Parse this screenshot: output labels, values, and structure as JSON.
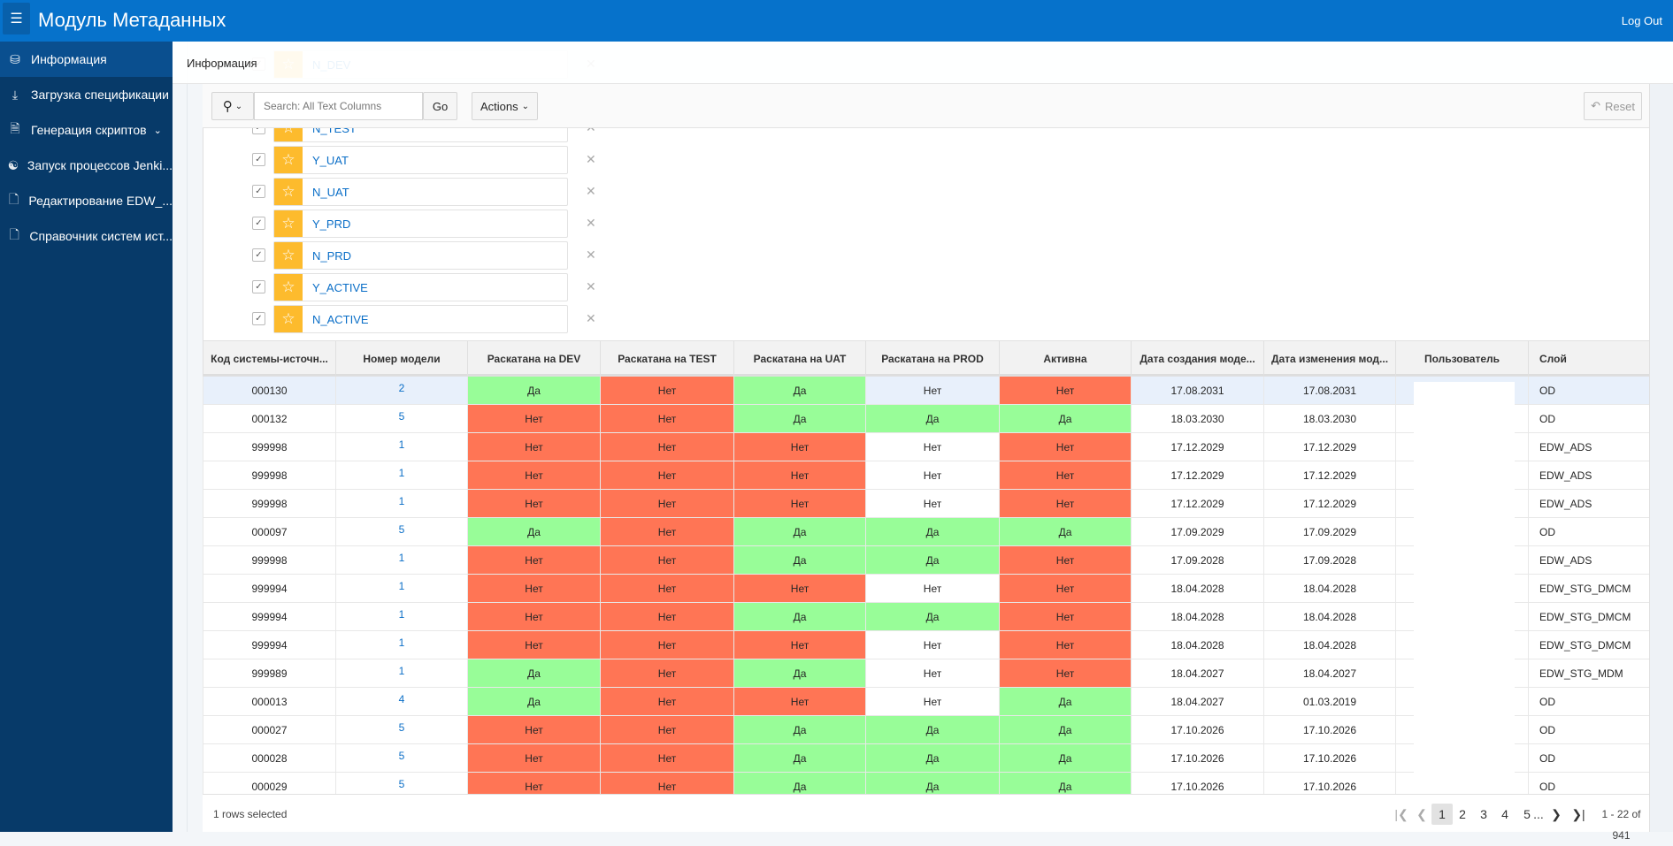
{
  "header": {
    "title": "Модуль Метаданных",
    "logout": "Log Out",
    "menu_icon": "hamburger-icon"
  },
  "sidebar": {
    "items": [
      {
        "label": "Информация",
        "icon": "database-icon",
        "active": true
      },
      {
        "label": "Загрузка спецификации",
        "icon": "download-icon"
      },
      {
        "label": "Генерация скриптов",
        "icon": "file-code-icon",
        "expandable": true
      },
      {
        "label": "Запуск процессов Jenki...",
        "icon": "jenkins-icon"
      },
      {
        "label": "Редактирование EDW_...",
        "icon": "file-icon"
      },
      {
        "label": "Справочник систем ист...",
        "icon": "file-icon"
      }
    ]
  },
  "breadcrumb": {
    "current": "Информация"
  },
  "toolbar": {
    "search_placeholder": "Search: All Text Columns",
    "search_value": "",
    "go": "Go",
    "actions": "Actions",
    "reset": "Reset"
  },
  "highlights": [
    {
      "name": "N_DEV",
      "checked": true
    },
    {
      "name": "N_TEST",
      "checked": true
    },
    {
      "name": "Y_UAT",
      "checked": true
    },
    {
      "name": "N_UAT",
      "checked": true
    },
    {
      "name": "Y_PRD",
      "checked": true
    },
    {
      "name": "N_PRD",
      "checked": true
    },
    {
      "name": "Y_ACTIVE",
      "checked": true
    },
    {
      "name": "N_ACTIVE",
      "checked": true
    }
  ],
  "colors": {
    "yes": "#98fd98",
    "no": "#ff7555",
    "header": "#0672cb",
    "sidebar": "#073a69"
  },
  "table": {
    "columns": [
      "Код системы-источн...",
      "Номер модели",
      "Раскатана на DEV",
      "Раскатана на TEST",
      "Раскатана на UAT",
      "Раскатана на PROD",
      "Активна",
      "Дата создания моде...",
      "Дата изменения мод...",
      "Пользователь",
      "Слой"
    ],
    "rows": [
      [
        "000130",
        "2",
        "Да",
        "Нет",
        "Да",
        "Нет",
        "Нет",
        "17.08.2031",
        "17.08.2031",
        "",
        "OD"
      ],
      [
        "000132",
        "5",
        "Нет",
        "Нет",
        "Да",
        "Да",
        "Да",
        "18.03.2030",
        "18.03.2030",
        "",
        "OD"
      ],
      [
        "999998",
        "1",
        "Нет",
        "Нет",
        "Нет",
        "Нет",
        "Нет",
        "17.12.2029",
        "17.12.2029",
        "",
        "EDW_ADS"
      ],
      [
        "999998",
        "1",
        "Нет",
        "Нет",
        "Нет",
        "Нет",
        "Нет",
        "17.12.2029",
        "17.12.2029",
        "",
        "EDW_ADS"
      ],
      [
        "999998",
        "1",
        "Нет",
        "Нет",
        "Нет",
        "Нет",
        "Нет",
        "17.12.2029",
        "17.12.2029",
        "",
        "EDW_ADS"
      ],
      [
        "000097",
        "5",
        "Да",
        "Нет",
        "Да",
        "Да",
        "Да",
        "17.09.2029",
        "17.09.2029",
        "",
        "OD"
      ],
      [
        "999998",
        "1",
        "Нет",
        "Нет",
        "Да",
        "Да",
        "Нет",
        "17.09.2028",
        "17.09.2028",
        "",
        "EDW_ADS"
      ],
      [
        "999994",
        "1",
        "Нет",
        "Нет",
        "Нет",
        "Нет",
        "Нет",
        "18.04.2028",
        "18.04.2028",
        "",
        "EDW_STG_DMCM"
      ],
      [
        "999994",
        "1",
        "Нет",
        "Нет",
        "Да",
        "Да",
        "Нет",
        "18.04.2028",
        "18.04.2028",
        "",
        "EDW_STG_DMCM"
      ],
      [
        "999994",
        "1",
        "Нет",
        "Нет",
        "Нет",
        "Нет",
        "Нет",
        "18.04.2028",
        "18.04.2028",
        "",
        "EDW_STG_DMCM"
      ],
      [
        "999989",
        "1",
        "Да",
        "Нет",
        "Да",
        "Нет",
        "Нет",
        "18.04.2027",
        "18.04.2027",
        "",
        "EDW_STG_MDM"
      ],
      [
        "000013",
        "4",
        "Да",
        "Нет",
        "Нет",
        "Нет",
        "Да",
        "18.04.2027",
        "01.03.2019",
        "",
        "OD"
      ],
      [
        "000027",
        "5",
        "Нет",
        "Нет",
        "Да",
        "Да",
        "Да",
        "17.10.2026",
        "17.10.2026",
        "",
        "OD"
      ],
      [
        "000028",
        "5",
        "Нет",
        "Нет",
        "Да",
        "Да",
        "Да",
        "17.10.2026",
        "17.10.2026",
        "",
        "OD"
      ],
      [
        "000029",
        "5",
        "Нет",
        "Нет",
        "Да",
        "Да",
        "Да",
        "17.10.2026",
        "17.10.2026",
        "",
        "OD"
      ]
    ],
    "selected_row": 0
  },
  "footer": {
    "selection": "1 rows selected",
    "pages": [
      "1",
      "2",
      "3",
      "4",
      "5"
    ],
    "current_page": "1",
    "ellipsis": "...",
    "range": "1 - 22 of 941"
  }
}
